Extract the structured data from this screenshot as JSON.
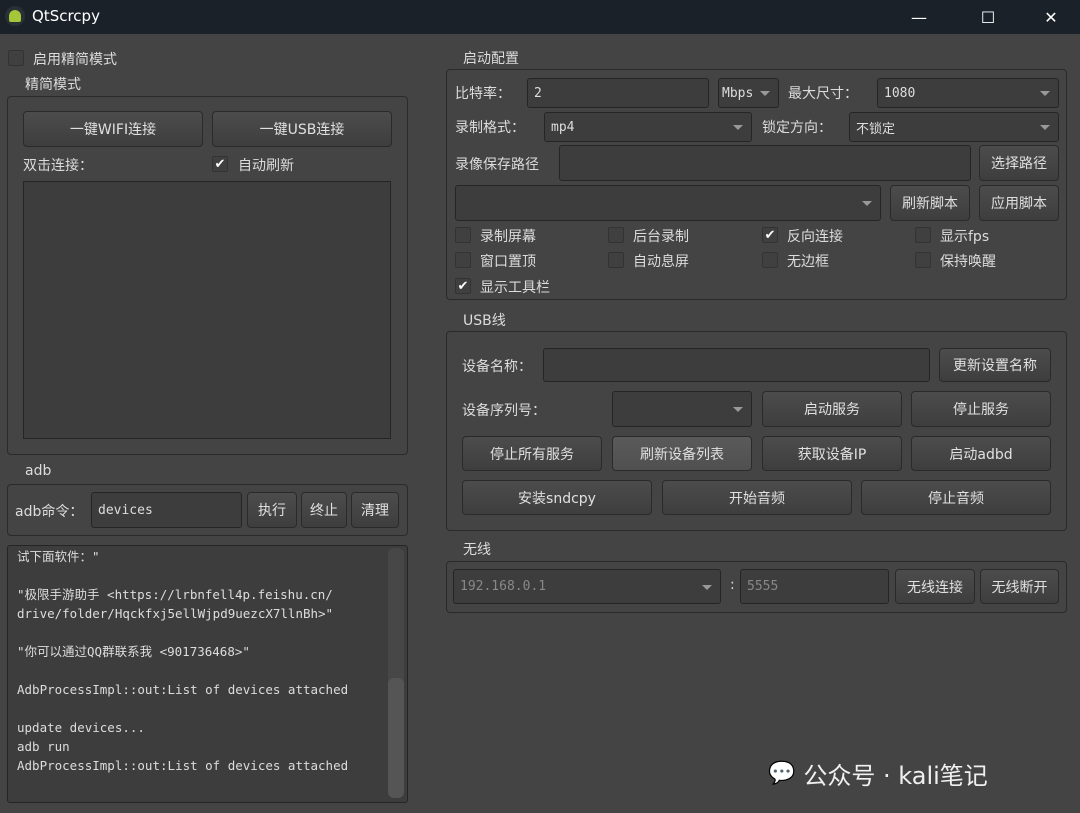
{
  "window": {
    "title": "QtScrcpy",
    "icon": "android-icon",
    "minimize": "—",
    "maximize": "☐",
    "close": "✕"
  },
  "simple": {
    "enable_label": "启用精简模式",
    "enable_checked": false,
    "group_title": "精简模式",
    "wifi_btn": "一键WIFI连接",
    "usb_btn": "一键USB连接",
    "dblclick_label": "双击连接：",
    "auto_refresh_label": "自动刷新",
    "auto_refresh_checked": true
  },
  "adb": {
    "group_title": "adb",
    "cmd_label": "adb命令：",
    "cmd_value": "devices",
    "exec": "执行",
    "stop": "终止",
    "clear": "清理",
    "log": "试下面软件：\"\n\n\"极限手游助手 <https://lrbnfell4p.feishu.cn/\ndrive/folder/Hqckfxj5ellWjpd9uezcX7llnBh>\"\n\n\"你可以通过QQ群联系我 <901736468>\"\n\nAdbProcessImpl::out:List of devices attached\n\nupdate devices...\nadb run\nAdbProcessImpl::out:List of devices attached"
  },
  "config": {
    "group_title": "启动配置",
    "bitrate_label": "比特率：",
    "bitrate_value": "2",
    "bitrate_unit": "Mbps",
    "maxsize_label": "最大尺寸：",
    "maxsize_value": "1080",
    "format_label": "录制格式：",
    "format_value": "mp4",
    "orient_label": "锁定方向：",
    "orient_value": "不锁定",
    "path_label": "录像保存路径",
    "path_value": "",
    "select_path": "选择路径",
    "script_value": "",
    "refresh_script": "刷新脚本",
    "apply_script": "应用脚本",
    "checks": [
      {
        "label": "录制屏幕",
        "checked": false
      },
      {
        "label": "后台录制",
        "checked": false
      },
      {
        "label": "反向连接",
        "checked": true
      },
      {
        "label": "显示fps",
        "checked": false
      },
      {
        "label": "窗口置顶",
        "checked": false
      },
      {
        "label": "自动息屏",
        "checked": false
      },
      {
        "label": "无边框",
        "checked": false
      },
      {
        "label": "保持唤醒",
        "checked": false
      },
      {
        "label": "显示工具栏",
        "checked": true
      }
    ]
  },
  "usb": {
    "group_title": "USB线",
    "name_label": "设备名称：",
    "name_value": "",
    "update_name": "更新设置名称",
    "serial_label": "设备序列号：",
    "serial_value": "",
    "start_service": "启动服务",
    "stop_service": "停止服务",
    "stop_all": "停止所有服务",
    "refresh_list": "刷新设备列表",
    "get_ip": "获取设备IP",
    "start_adbd": "启动adbd",
    "install_sndcpy": "安装sndcpy",
    "start_audio": "开始音频",
    "stop_audio": "停止音频"
  },
  "wireless": {
    "group_title": "无线",
    "ip_placeholder": "192.168.0.1",
    "colon": ":",
    "port_placeholder": "5555",
    "connect": "无线连接",
    "disconnect": "无线断开"
  },
  "watermark": "公众号 · kali笔记"
}
